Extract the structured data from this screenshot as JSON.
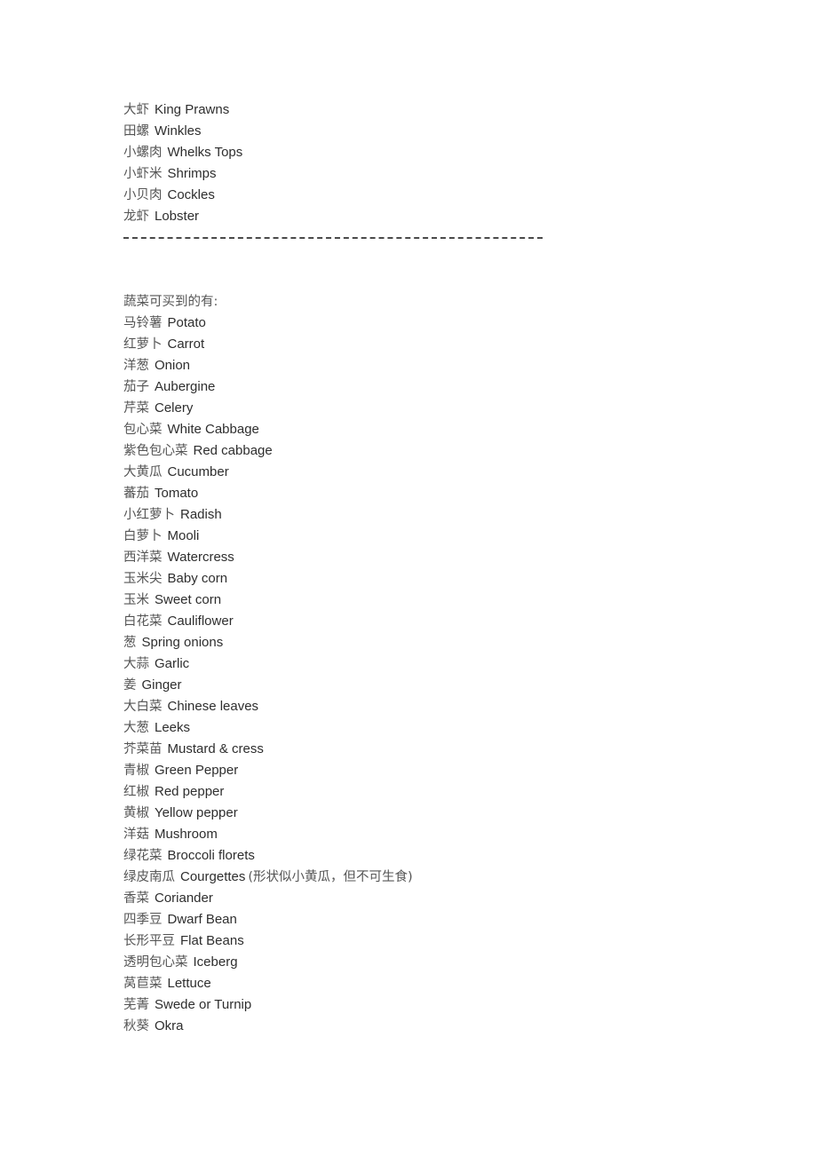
{
  "document": {
    "type": "bilingual-glossary",
    "language_pair": "Chinese-English",
    "seafood_section": {
      "entries": [
        {
          "cjk": "大虾",
          "latin": "King Prawns"
        },
        {
          "cjk": "田螺",
          "latin": "Winkles"
        },
        {
          "cjk": "小螺肉",
          "latin": "Whelks Tops"
        },
        {
          "cjk": "小虾米",
          "latin": "Shrimps"
        },
        {
          "cjk": "小贝肉",
          "latin": "Cockles"
        },
        {
          "cjk": "龙虾",
          "latin": "Lobster"
        }
      ]
    },
    "divider": {
      "style": "dashed",
      "label": "section-divider"
    },
    "vegetable_section": {
      "heading": "蔬菜可买到的有:",
      "entries": [
        {
          "cjk": "马铃薯",
          "latin": "Potato",
          "note": ""
        },
        {
          "cjk": "红萝卜",
          "latin": "Carrot",
          "note": ""
        },
        {
          "cjk": "洋葱",
          "latin": "Onion",
          "note": ""
        },
        {
          "cjk": "茄子",
          "latin": "Aubergine",
          "note": ""
        },
        {
          "cjk": "芹菜",
          "latin": "Celery",
          "note": ""
        },
        {
          "cjk": "包心菜",
          "latin": "White Cabbage",
          "note": ""
        },
        {
          "cjk": "紫色包心菜",
          "latin": "Red cabbage",
          "note": ""
        },
        {
          "cjk": "大黄瓜",
          "latin": "Cucumber",
          "note": ""
        },
        {
          "cjk": "蕃茄",
          "latin": "Tomato",
          "note": ""
        },
        {
          "cjk": "小红萝卜",
          "latin": "Radish",
          "note": ""
        },
        {
          "cjk": "白萝卜",
          "latin": "Mooli",
          "note": ""
        },
        {
          "cjk": "西洋菜",
          "latin": "Watercress",
          "note": ""
        },
        {
          "cjk": "玉米尖",
          "latin": "Baby corn",
          "note": ""
        },
        {
          "cjk": "玉米",
          "latin": "Sweet corn",
          "note": ""
        },
        {
          "cjk": "白花菜",
          "latin": "Cauliflower",
          "note": ""
        },
        {
          "cjk": "葱",
          "latin": "Spring onions",
          "note": ""
        },
        {
          "cjk": "大蒜",
          "latin": "Garlic",
          "note": ""
        },
        {
          "cjk": "姜",
          "latin": "Ginger",
          "note": ""
        },
        {
          "cjk": "大白菜",
          "latin": "Chinese leaves",
          "note": ""
        },
        {
          "cjk": "大葱",
          "latin": "Leeks",
          "note": ""
        },
        {
          "cjk": "芥菜苗",
          "latin": "Mustard & cress",
          "note": ""
        },
        {
          "cjk": "青椒",
          "latin": "Green Pepper",
          "note": ""
        },
        {
          "cjk": "红椒",
          "latin": "Red pepper",
          "note": ""
        },
        {
          "cjk": "黄椒",
          "latin": "Yellow pepper",
          "note": ""
        },
        {
          "cjk": "洋菇",
          "latin": "Mushroom",
          "note": ""
        },
        {
          "cjk": "绿花菜",
          "latin": "Broccoli florets",
          "note": ""
        },
        {
          "cjk": "绿皮南瓜",
          "latin": "Courgettes",
          "note": "(形状似小黄瓜，但不可生食)"
        },
        {
          "cjk": "香菜",
          "latin": "Coriander",
          "note": ""
        },
        {
          "cjk": "四季豆",
          "latin": "Dwarf Bean",
          "note": ""
        },
        {
          "cjk": "长形平豆",
          "latin": "Flat Beans",
          "note": ""
        },
        {
          "cjk": "透明包心菜",
          "latin": "Iceberg",
          "note": ""
        },
        {
          "cjk": "莴苣菜",
          "latin": "Lettuce",
          "note": ""
        },
        {
          "cjk": "芜菁",
          "latin": "Swede or Turnip",
          "note": ""
        },
        {
          "cjk": "秋葵",
          "latin": "Okra",
          "note": ""
        }
      ]
    }
  },
  "colors": {
    "page_background": "#ffffff",
    "cjk_text": "#555555",
    "latin_text": "#2e2e2e",
    "divider": "#4a4a4a"
  }
}
